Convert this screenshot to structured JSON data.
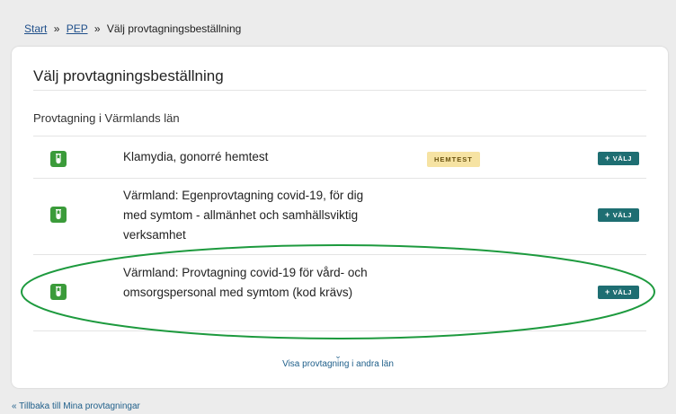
{
  "breadcrumb": {
    "start": "Start",
    "sep1": "»",
    "pep": "PEP",
    "sep2": "»",
    "current": "Välj provtagningsbeställning"
  },
  "page": {
    "title": "Välj provtagningsbeställning",
    "section_title": "Provtagning i Värmlands län"
  },
  "rows": [
    {
      "text": "Klamydia, gonorré hemtest",
      "badge": "HEMTEST",
      "button": "VÄLJ",
      "icon": "test-tube-icon"
    },
    {
      "text": "Värmland: Egenprovtagning covid-19, för dig med symtom - allmänhet och samhällsviktig verksamhet",
      "badge": "",
      "button": "VÄLJ",
      "icon": "test-tube-icon"
    },
    {
      "text": "Värmland: Provtagning covid-19 för vård- och omsorgspersonal med symtom (kod krävs)",
      "badge": "",
      "button": "VÄLJ",
      "icon": "test-tube-icon"
    }
  ],
  "button_prefix": "+",
  "more": {
    "chevron": "⌄",
    "label": "Visa provtagning i andra län"
  },
  "back": {
    "label": "« Tillbaka till Mina provtagningar"
  },
  "colors": {
    "primary_button": "#1e6e72",
    "icon_green": "#3b9b3a",
    "badge_bg": "#f6e3a3",
    "highlight": "#1d9a3e",
    "link": "#1f5f8a"
  }
}
